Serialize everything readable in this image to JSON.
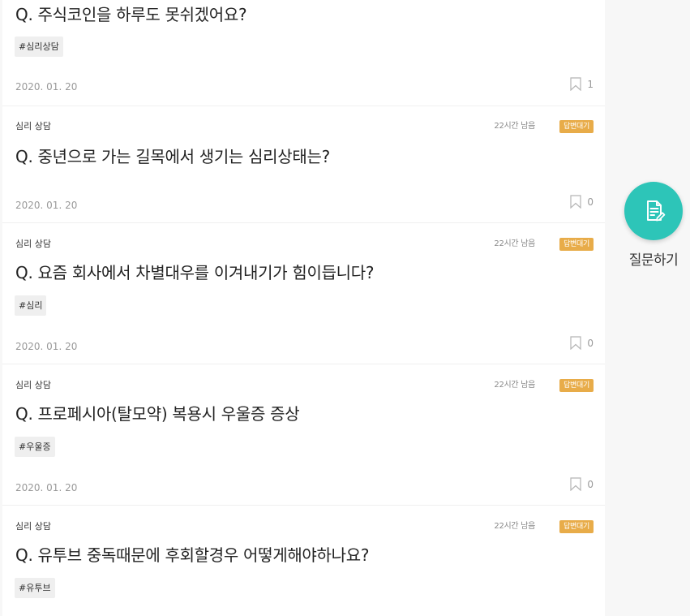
{
  "posts": [
    {
      "title": "Q. 주식코인을 하루도 못쉬겠어요?",
      "tag": "#심리상담",
      "date": "2020. 01. 20",
      "bookmarks": "1"
    },
    {
      "category": "심리 상담",
      "remaining": "22시간 남음",
      "status": "답변대기",
      "title": "Q. 중년으로 가는 길목에서 생기는 심리상태는?",
      "date": "2020. 01. 20",
      "bookmarks": "0"
    },
    {
      "category": "심리 상담",
      "remaining": "22시간 남음",
      "status": "답변대기",
      "title": "Q. 요즘 회사에서 차별대우를 이겨내기가 힘이듭니다?",
      "tag": "#심리",
      "date": "2020. 01. 20",
      "bookmarks": "0"
    },
    {
      "category": "심리 상담",
      "remaining": "22시간 남음",
      "status": "답변대기",
      "title": "Q. 프로페시아(탈모약) 복용시 우울증 증상",
      "tag": "#우울증",
      "date": "2020. 01. 20",
      "bookmarks": "0"
    },
    {
      "category": "심리 상담",
      "remaining": "22시간 남음",
      "status": "답변대기",
      "title": "Q. 유투브 중독때문에 후회할경우 어떻게해야하나요?",
      "tag": "#유투브"
    }
  ],
  "fab": {
    "label": "질문하기",
    "icon": "write-question-icon"
  },
  "colors": {
    "status_badge": "#e8ac49",
    "fab": "#2dc5b8"
  }
}
